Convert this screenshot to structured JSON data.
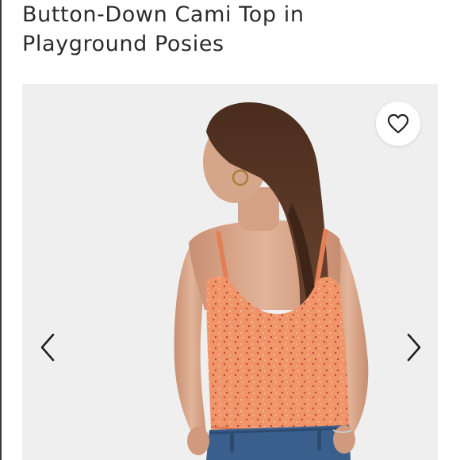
{
  "product": {
    "title_line1": "Button-Down Cami Top in",
    "title_line2": "Playground Posies"
  },
  "gallery": {
    "favorite_icon": "heart-outline-icon",
    "prev_icon": "chevron-left-icon",
    "next_icon": "chevron-right-icon"
  },
  "colors": {
    "top_fabric": "#f0956a",
    "background": "#efefef",
    "hair": "#5a3724",
    "skin": "#d9a98c",
    "denim": "#3b5f8d"
  }
}
